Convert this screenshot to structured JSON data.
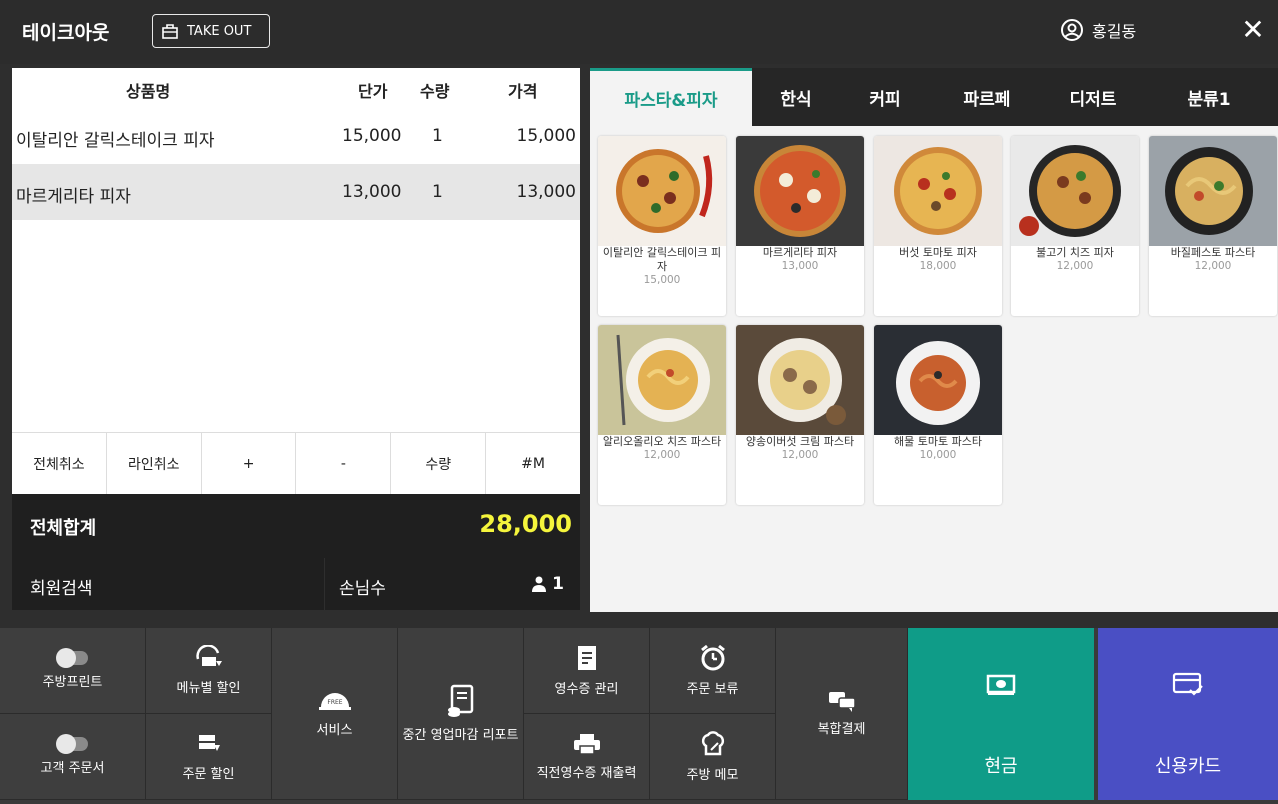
{
  "header": {
    "title": "테이크아웃",
    "takeout_label": "TAKE OUT",
    "user_name": "홍길동",
    "close_symbol": "✕"
  },
  "order": {
    "columns": {
      "name": "상품명",
      "unit_price": "단가",
      "qty": "수량",
      "price": "가격"
    },
    "rows": [
      {
        "name": "이탈리안 갈릭스테이크 피자",
        "unit_price": "15,000",
        "qty": "1",
        "price": "15,000"
      },
      {
        "name": "마르게리타 피자",
        "unit_price": "13,000",
        "qty": "1",
        "price": "13,000"
      }
    ],
    "actions": [
      "전체취소",
      "라인취소",
      "+",
      "-",
      "수량",
      "#M"
    ],
    "total_label": "전체합계",
    "total_value": "28,000",
    "member_search": "회원검색",
    "guest_label": "손님수",
    "guest_count": "1"
  },
  "menu": {
    "tabs": [
      "파스타&피자",
      "한식",
      "커피",
      "파르페",
      "디저트",
      "분류1"
    ],
    "active_tab": "파스타&피자",
    "items": [
      {
        "name": "이탈리안 갈릭스테이크 피자",
        "price": "15,000"
      },
      {
        "name": "마르게리타 피자",
        "price": "13,000"
      },
      {
        "name": "버섯 토마토 피자",
        "price": "18,000"
      },
      {
        "name": "불고기 치즈 피자",
        "price": "12,000"
      },
      {
        "name": "바질페스토 파스타",
        "price": "12,000"
      },
      {
        "name": "알리오올리오 치즈 파스타",
        "price": "12,000"
      },
      {
        "name": "양송이버섯 크림 파스타",
        "price": "12,000"
      },
      {
        "name": "해물 토마토 파스타",
        "price": "10,000"
      }
    ]
  },
  "functions": {
    "kitchen_print": "주방프린트",
    "customer_order": "고객 주문서",
    "menu_discount": "메뉴별 할인",
    "order_discount": "주문 할인",
    "service": "서비스",
    "service_badge": "FREE",
    "mid_report": "중간 영업마감 리포트",
    "receipt_manage": "영수증 관리",
    "reprint": "직전영수증 재출력",
    "order_hold": "주문 보류",
    "kitchen_memo": "주방 메모",
    "split_pay": "복합결제",
    "cash": "현금",
    "card": "신용카드"
  },
  "colors": {
    "accent": "#1a9b88",
    "cash_bg": "#0f9c88",
    "card_bg": "#4a4fc4",
    "total": "#f5f53c"
  }
}
